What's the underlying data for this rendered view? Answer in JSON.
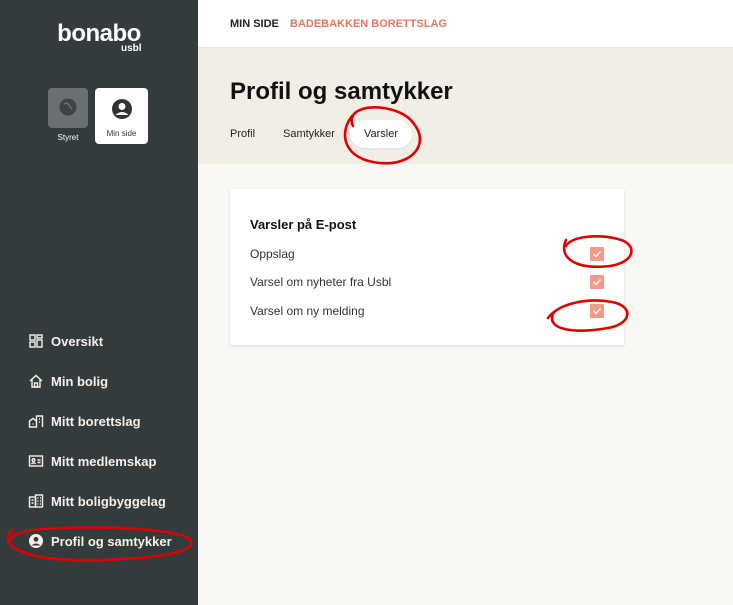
{
  "brand": {
    "name": "bonabo",
    "sub": "usbl"
  },
  "switcher": [
    {
      "label": "Styret",
      "icon": "globe-icon"
    },
    {
      "label": "Min side",
      "icon": "user-circle-icon"
    }
  ],
  "sidebar": {
    "items": [
      {
        "label": "Oversikt",
        "icon": "grid-icon"
      },
      {
        "label": "Min bolig",
        "icon": "home-icon"
      },
      {
        "label": "Mitt borettslag",
        "icon": "buildings-icon"
      },
      {
        "label": "Mitt medlemskap",
        "icon": "id-card-icon"
      },
      {
        "label": "Mitt boligbyggelag",
        "icon": "office-icon"
      },
      {
        "label": "Profil og samtykker",
        "icon": "user-circle-icon",
        "active": true
      }
    ]
  },
  "topbar": {
    "crumb1": "MIN SIDE",
    "crumb2": "BADEBAKKEN BORETTSLAG"
  },
  "page": {
    "title": "Profil og samtykker",
    "tabs": [
      {
        "label": "Profil"
      },
      {
        "label": "Samtykker"
      },
      {
        "label": "Varsler",
        "active": true
      }
    ]
  },
  "card": {
    "title": "Varsler på E-post",
    "rows": [
      {
        "label": "Oppslag",
        "checked": true
      },
      {
        "label": "Varsel om nyheter fra Usbl",
        "checked": true
      },
      {
        "label": "Varsel om ny melding",
        "checked": true
      }
    ]
  },
  "colors": {
    "sidebar": "#343b3d",
    "accent": "#e77461",
    "checkbox": "#f29a88",
    "annotation": "#e00000"
  }
}
